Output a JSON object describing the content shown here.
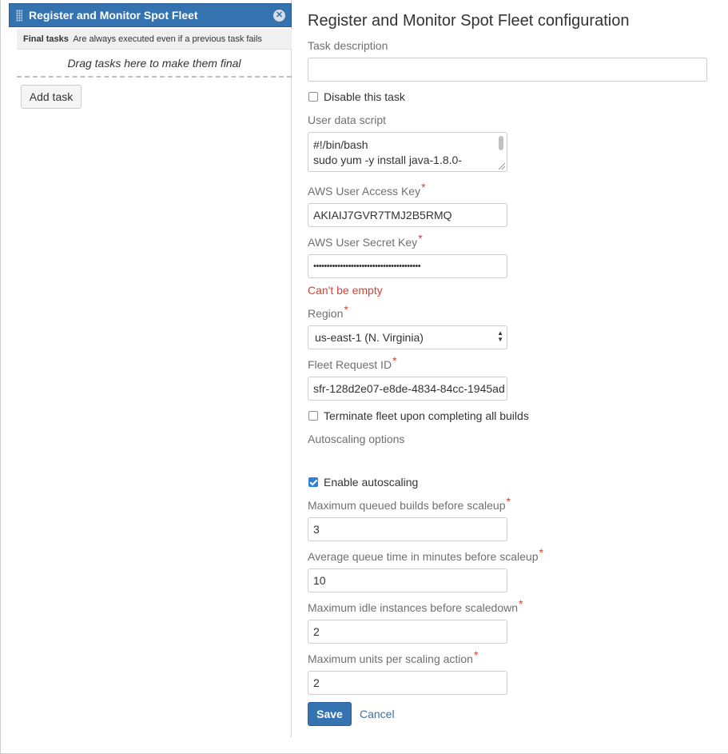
{
  "sidebar": {
    "task_title": "Register and Monitor Spot Fleet",
    "final_tasks_label": "Final tasks",
    "final_tasks_desc": "Are always executed even if a previous task fails",
    "drop_zone_text": "Drag tasks here to make them final",
    "add_task_label": "Add task"
  },
  "form": {
    "title": "Register and Monitor Spot Fleet configuration",
    "task_description_label": "Task description",
    "task_description_value": "",
    "disable_task_label": "Disable this task",
    "disable_task_checked": false,
    "user_data_label": "User data script",
    "user_data_line1": "#!/bin/bash",
    "user_data_line2": "sudo yum -y install java-1.8.0-",
    "access_key_label": "AWS User Access Key",
    "access_key_value": "AKIAIJ7GVR7TMJ2B5RMQ",
    "secret_key_label": "AWS User Secret Key",
    "secret_key_value": "••••••••••••••••••••••••••••••••••••••••",
    "secret_key_error": "Can't be empty",
    "region_label": "Region",
    "region_value": "us-east-1 (N. Virginia)",
    "fleet_id_label": "Fleet Request ID",
    "fleet_id_value": "sfr-128d2e07-e8de-4834-84cc-1945ad",
    "terminate_label": "Terminate fleet upon completing all builds",
    "terminate_checked": false,
    "autoscaling_heading": "Autoscaling options",
    "enable_autoscaling_label": "Enable autoscaling",
    "enable_autoscaling_checked": true,
    "max_queued_label": "Maximum queued builds before scaleup",
    "max_queued_value": "3",
    "avg_queue_label": "Average queue time in minutes before scaleup",
    "avg_queue_value": "10",
    "max_idle_label": "Maximum idle instances before scaledown",
    "max_idle_value": "2",
    "max_units_label": "Maximum units per scaling action",
    "max_units_value": "2",
    "required_marker": "*",
    "save_label": "Save",
    "cancel_label": "Cancel"
  },
  "colors": {
    "accent": "#3572b0",
    "error": "#d04437",
    "checkbox_checked": "#2e7fd7"
  }
}
